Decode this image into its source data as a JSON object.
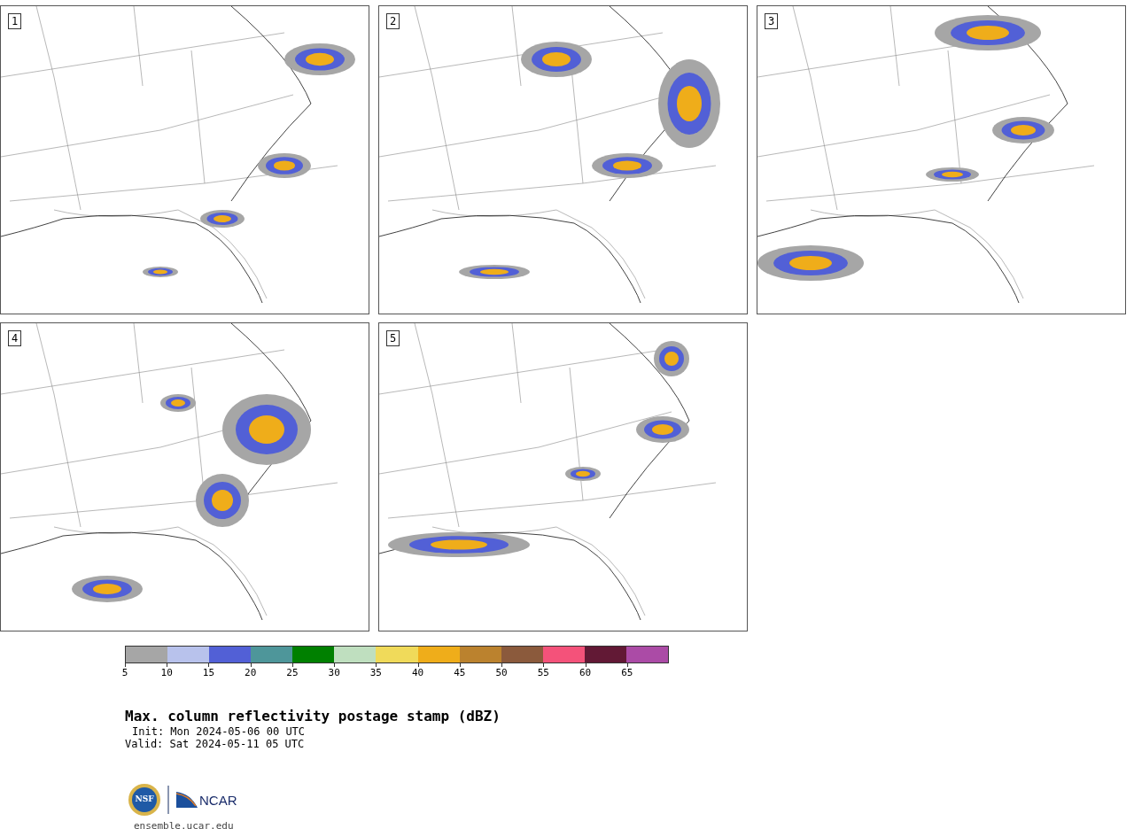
{
  "panels": [
    {
      "label": "1"
    },
    {
      "label": "2"
    },
    {
      "label": "3"
    },
    {
      "label": "4"
    },
    {
      "label": "5"
    }
  ],
  "colorbar": {
    "bins": [
      {
        "color": "#a6a6a6"
      },
      {
        "color": "#b8c2ec"
      },
      {
        "color": "#5260d6"
      },
      {
        "color": "#4e969a"
      },
      {
        "color": "#008000"
      },
      {
        "color": "#bfdfbf"
      },
      {
        "color": "#f0da5a"
      },
      {
        "color": "#efad1a"
      },
      {
        "color": "#bb822e"
      },
      {
        "color": "#8b5a3c"
      },
      {
        "color": "#f4527a"
      },
      {
        "color": "#621935"
      },
      {
        "color": "#ab4ba6"
      }
    ],
    "ticks": [
      "5",
      "10",
      "15",
      "20",
      "25",
      "30",
      "35",
      "40",
      "45",
      "50",
      "55",
      "60",
      "65"
    ]
  },
  "title": "Max. column reflectivity postage stamp (dBZ)",
  "init": "Init: Mon 2024-05-06 00 UTC",
  "valid": "Valid: Sat 2024-05-11 05 UTC",
  "logos": {
    "nsf": "NSF",
    "ncar": "NCAR"
  },
  "url": "ensemble.ucar.edu"
}
